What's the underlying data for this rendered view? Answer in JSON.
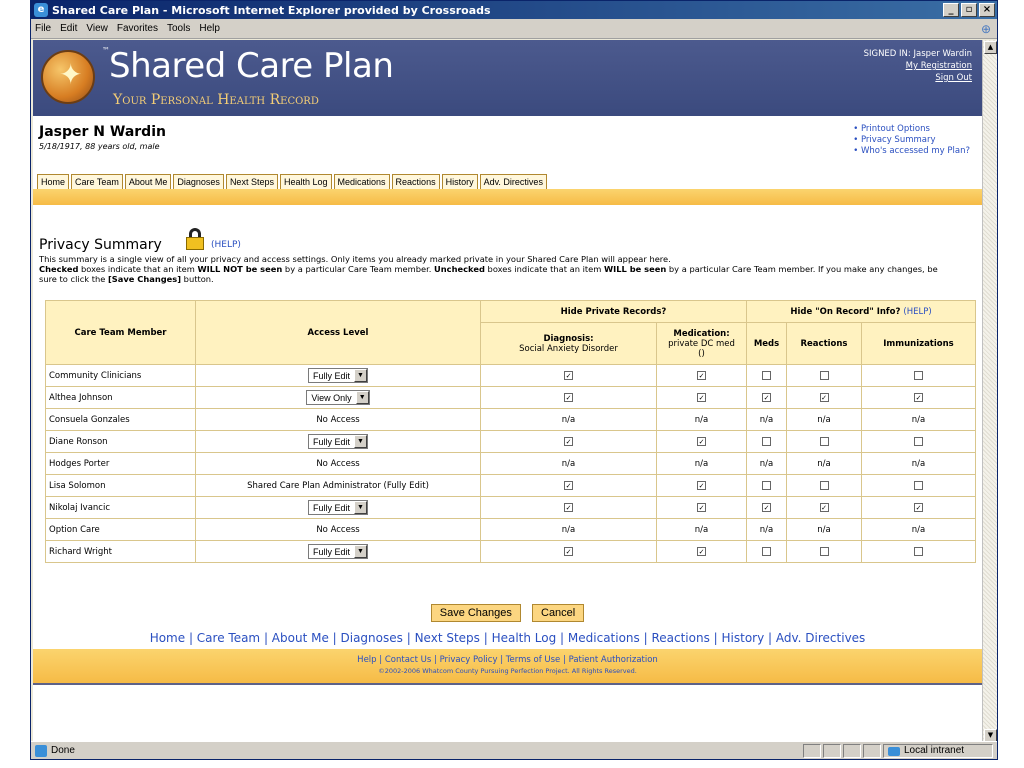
{
  "window": {
    "title": "Shared Care Plan - Microsoft Internet Explorer provided by Crossroads",
    "menu": [
      "File",
      "Edit",
      "View",
      "Favorites",
      "Tools",
      "Help"
    ],
    "status_text": "Done",
    "zone_text": "Local intranet"
  },
  "header": {
    "title": "Shared Care Plan",
    "tm": "™",
    "subtitle": "Your Personal Health Record",
    "signed_in": "SIGNED IN: Jasper Wardin",
    "my_registration": "My Registration",
    "sign_out": "Sign Out"
  },
  "patient": {
    "name": "Jasper N Wardin",
    "info": "5/18/1917, 88 years old, male"
  },
  "quick_links": [
    "Printout Options",
    "Privacy Summary",
    "Who's accessed my Plan?"
  ],
  "tabs": [
    "Home",
    "Care Team",
    "About Me",
    "Diagnoses",
    "Next Steps",
    "Health Log",
    "Medications",
    "Reactions",
    "History",
    "Adv. Directives"
  ],
  "privacy": {
    "title": "Privacy Summary",
    "help": "(HELP)",
    "intro_1": "This summary is a single view of all your privacy and access settings. Only items you already marked private in your Shared Care Plan will appear here.",
    "checked": "Checked",
    "intro_2": " boxes indicate that an item ",
    "will_not": "WILL NOT be seen",
    "intro_3": " by a particular Care Team member. ",
    "unchecked": "Unchecked",
    "intro_4": " boxes indicate that an item ",
    "will_be": "WILL be seen",
    "intro_5": " by a particular Care Team member. If you make any changes, be sure to click the ",
    "save_ref": "[Save Changes]",
    "intro_6": " button."
  },
  "table": {
    "col_member": "Care Team Member",
    "col_access": "Access Level",
    "group_private": "Hide Private Records?",
    "group_onrecord": "Hide \"On Record\" Info?",
    "group_onrecord_help": "(HELP)",
    "diag_head": "Diagnosis:",
    "diag_sub": "Social Anxiety Disorder",
    "med_head": "Medication:",
    "med_sub": "private DC med",
    "med_sub2": "()",
    "col_meds": "Meds",
    "col_reactions": "Reactions",
    "col_immun": "Immunizations",
    "rows": [
      {
        "member": "Community Clinicians",
        "access": "Fully Edit",
        "access_type": "select",
        "diag": true,
        "med": true,
        "meds": false,
        "reactions": false,
        "immun": false
      },
      {
        "member": "Althea Johnson",
        "access": "View Only",
        "access_type": "select",
        "diag": true,
        "med": true,
        "meds": true,
        "reactions": true,
        "immun": true
      },
      {
        "member": "Consuela Gonzales",
        "access": "No Access",
        "access_type": "text",
        "na": "n/a"
      },
      {
        "member": "Diane Ronson",
        "access": "Fully Edit",
        "access_type": "select",
        "diag": true,
        "med": true,
        "meds": false,
        "reactions": false,
        "immun": false
      },
      {
        "member": "Hodges Porter",
        "access": "No Access",
        "access_type": "text",
        "na": "n/a"
      },
      {
        "member": "Lisa Solomon",
        "access": "Shared Care Plan Administrator (Fully Edit)",
        "access_type": "text",
        "diag": true,
        "med": true,
        "meds": false,
        "reactions": false,
        "immun": false
      },
      {
        "member": "Nikolaj Ivancic",
        "access": "Fully Edit",
        "access_type": "select",
        "diag": true,
        "med": true,
        "meds": true,
        "reactions": true,
        "immun": true
      },
      {
        "member": "Option Care",
        "access": "No Access",
        "access_type": "text",
        "na": "n/a"
      },
      {
        "member": "Richard Wright",
        "access": "Fully Edit",
        "access_type": "select",
        "diag": true,
        "med": true,
        "meds": false,
        "reactions": false,
        "immun": false
      }
    ]
  },
  "buttons": {
    "save": "Save Changes",
    "cancel": "Cancel"
  },
  "bottom_nav": [
    "Home",
    "Care Team",
    "About Me",
    "Diagnoses",
    "Next Steps",
    "Health Log",
    "Medications",
    "Reactions",
    "History",
    "Adv. Directives"
  ],
  "footer": {
    "links": [
      "Help",
      "Contact Us",
      "Privacy Policy",
      "Terms of Use",
      "Patient Authorization"
    ],
    "copyright": "©2002-2006 Whatcom County Pursuing Perfection Project. All Rights Reserved."
  }
}
